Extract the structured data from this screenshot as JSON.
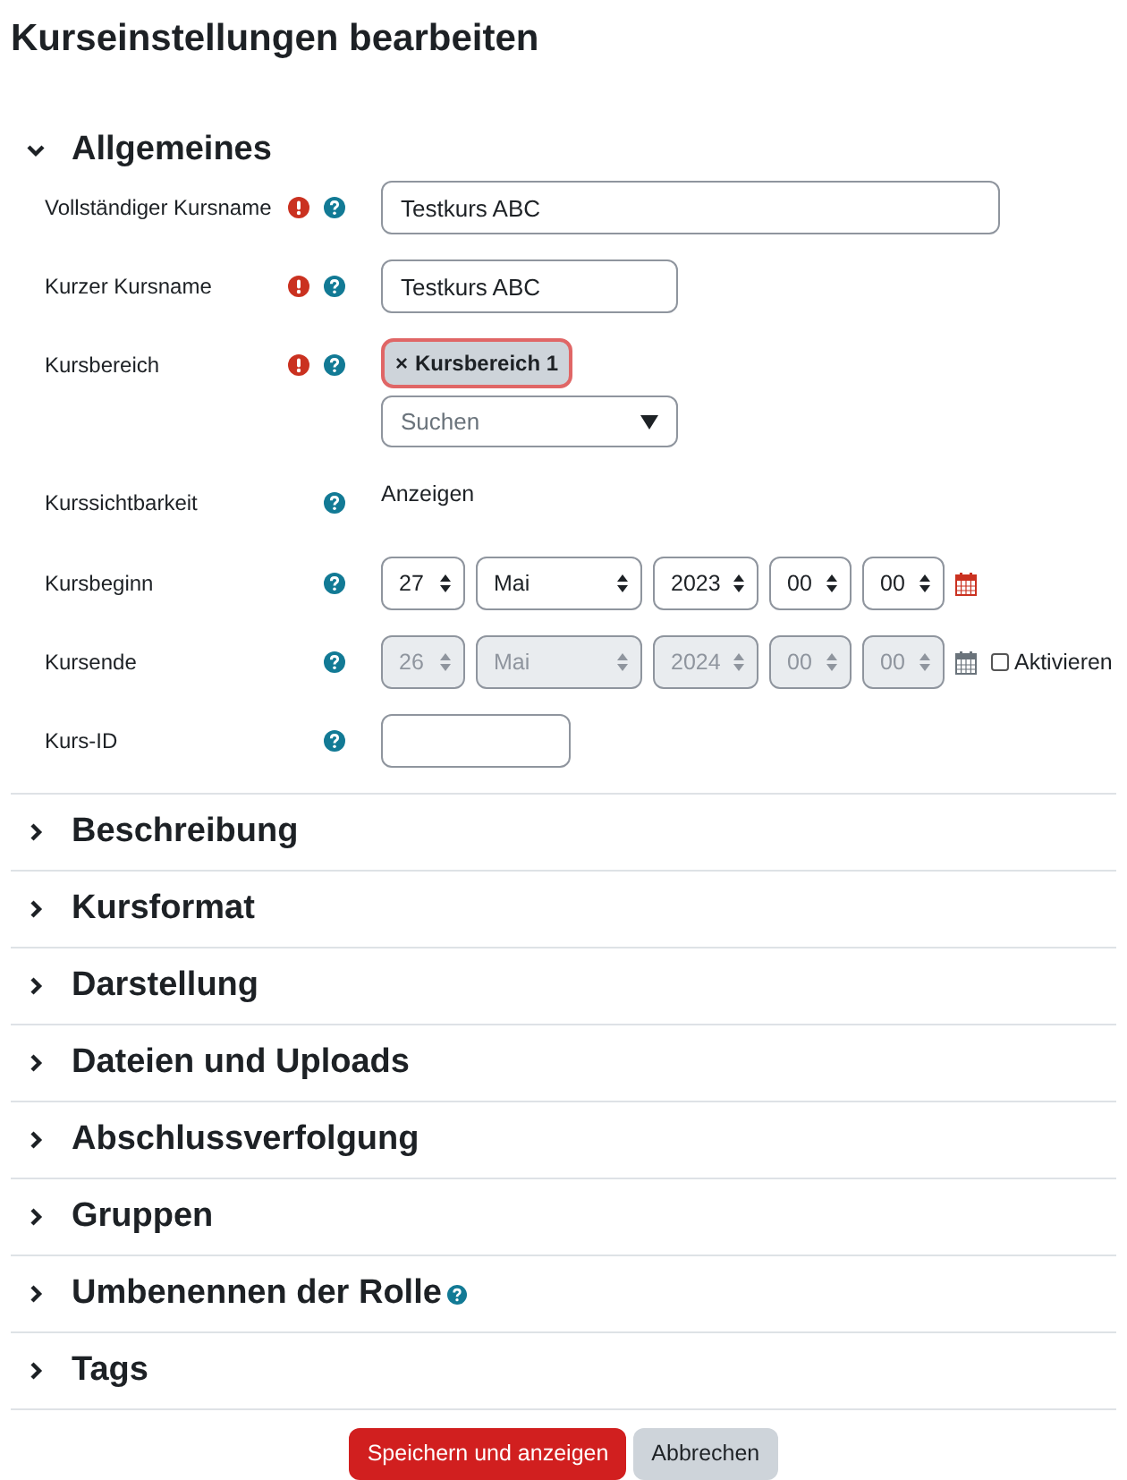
{
  "title": "Kurseinstellungen bearbeiten",
  "sections": [
    {
      "title": "Allgemeines",
      "expanded": true,
      "help": false,
      "fields": [
        {
          "kind": "text",
          "label": "Vollständiger Kursname",
          "required": true,
          "help": true,
          "value": "Testkurs ABC"
        },
        {
          "kind": "text",
          "label": "Kurzer Kursname",
          "required": true,
          "help": true,
          "value": "Testkurs ABC"
        },
        {
          "kind": "autocomplete",
          "label": "Kursbereich",
          "required": true,
          "help": true,
          "remove": "×",
          "selection": "Kursbereich 1",
          "placeholder": "Suchen"
        },
        {
          "kind": "static",
          "label": "Kurssichtbarkeit",
          "required": false,
          "help": true,
          "value": "Anzeigen"
        },
        {
          "kind": "date",
          "label": "Kursbeginn",
          "required": false,
          "help": true,
          "disabled": false,
          "parts": [
            "27",
            "Mai",
            "2023",
            "00",
            "00"
          ]
        },
        {
          "kind": "date",
          "label": "Kursende",
          "required": false,
          "help": true,
          "disabled": true,
          "parts": [
            "26",
            "Mai",
            "2024",
            "00",
            "00"
          ],
          "enable": {
            "label": "Aktivieren",
            "checked": false
          }
        },
        {
          "kind": "text",
          "label": "Kurs-ID",
          "required": false,
          "help": true
        }
      ]
    },
    {
      "title": "Beschreibung",
      "expanded": false,
      "help": false
    },
    {
      "title": "Kursformat",
      "expanded": false,
      "help": false
    },
    {
      "title": "Darstellung",
      "expanded": false,
      "help": false
    },
    {
      "title": "Dateien und Uploads",
      "expanded": false,
      "help": false
    },
    {
      "title": "Abschlussverfolgung",
      "expanded": false,
      "help": false
    },
    {
      "title": "Gruppen",
      "expanded": false,
      "help": false
    },
    {
      "title": "Umbenennen der Rolle",
      "expanded": false,
      "help": true
    },
    {
      "title": "Tags",
      "expanded": false,
      "help": false
    }
  ],
  "buttons": [
    {
      "label": "Speichern und anzeigen",
      "kind": "primary"
    },
    {
      "label": "Abbrechen",
      "kind": "secondary"
    }
  ]
}
